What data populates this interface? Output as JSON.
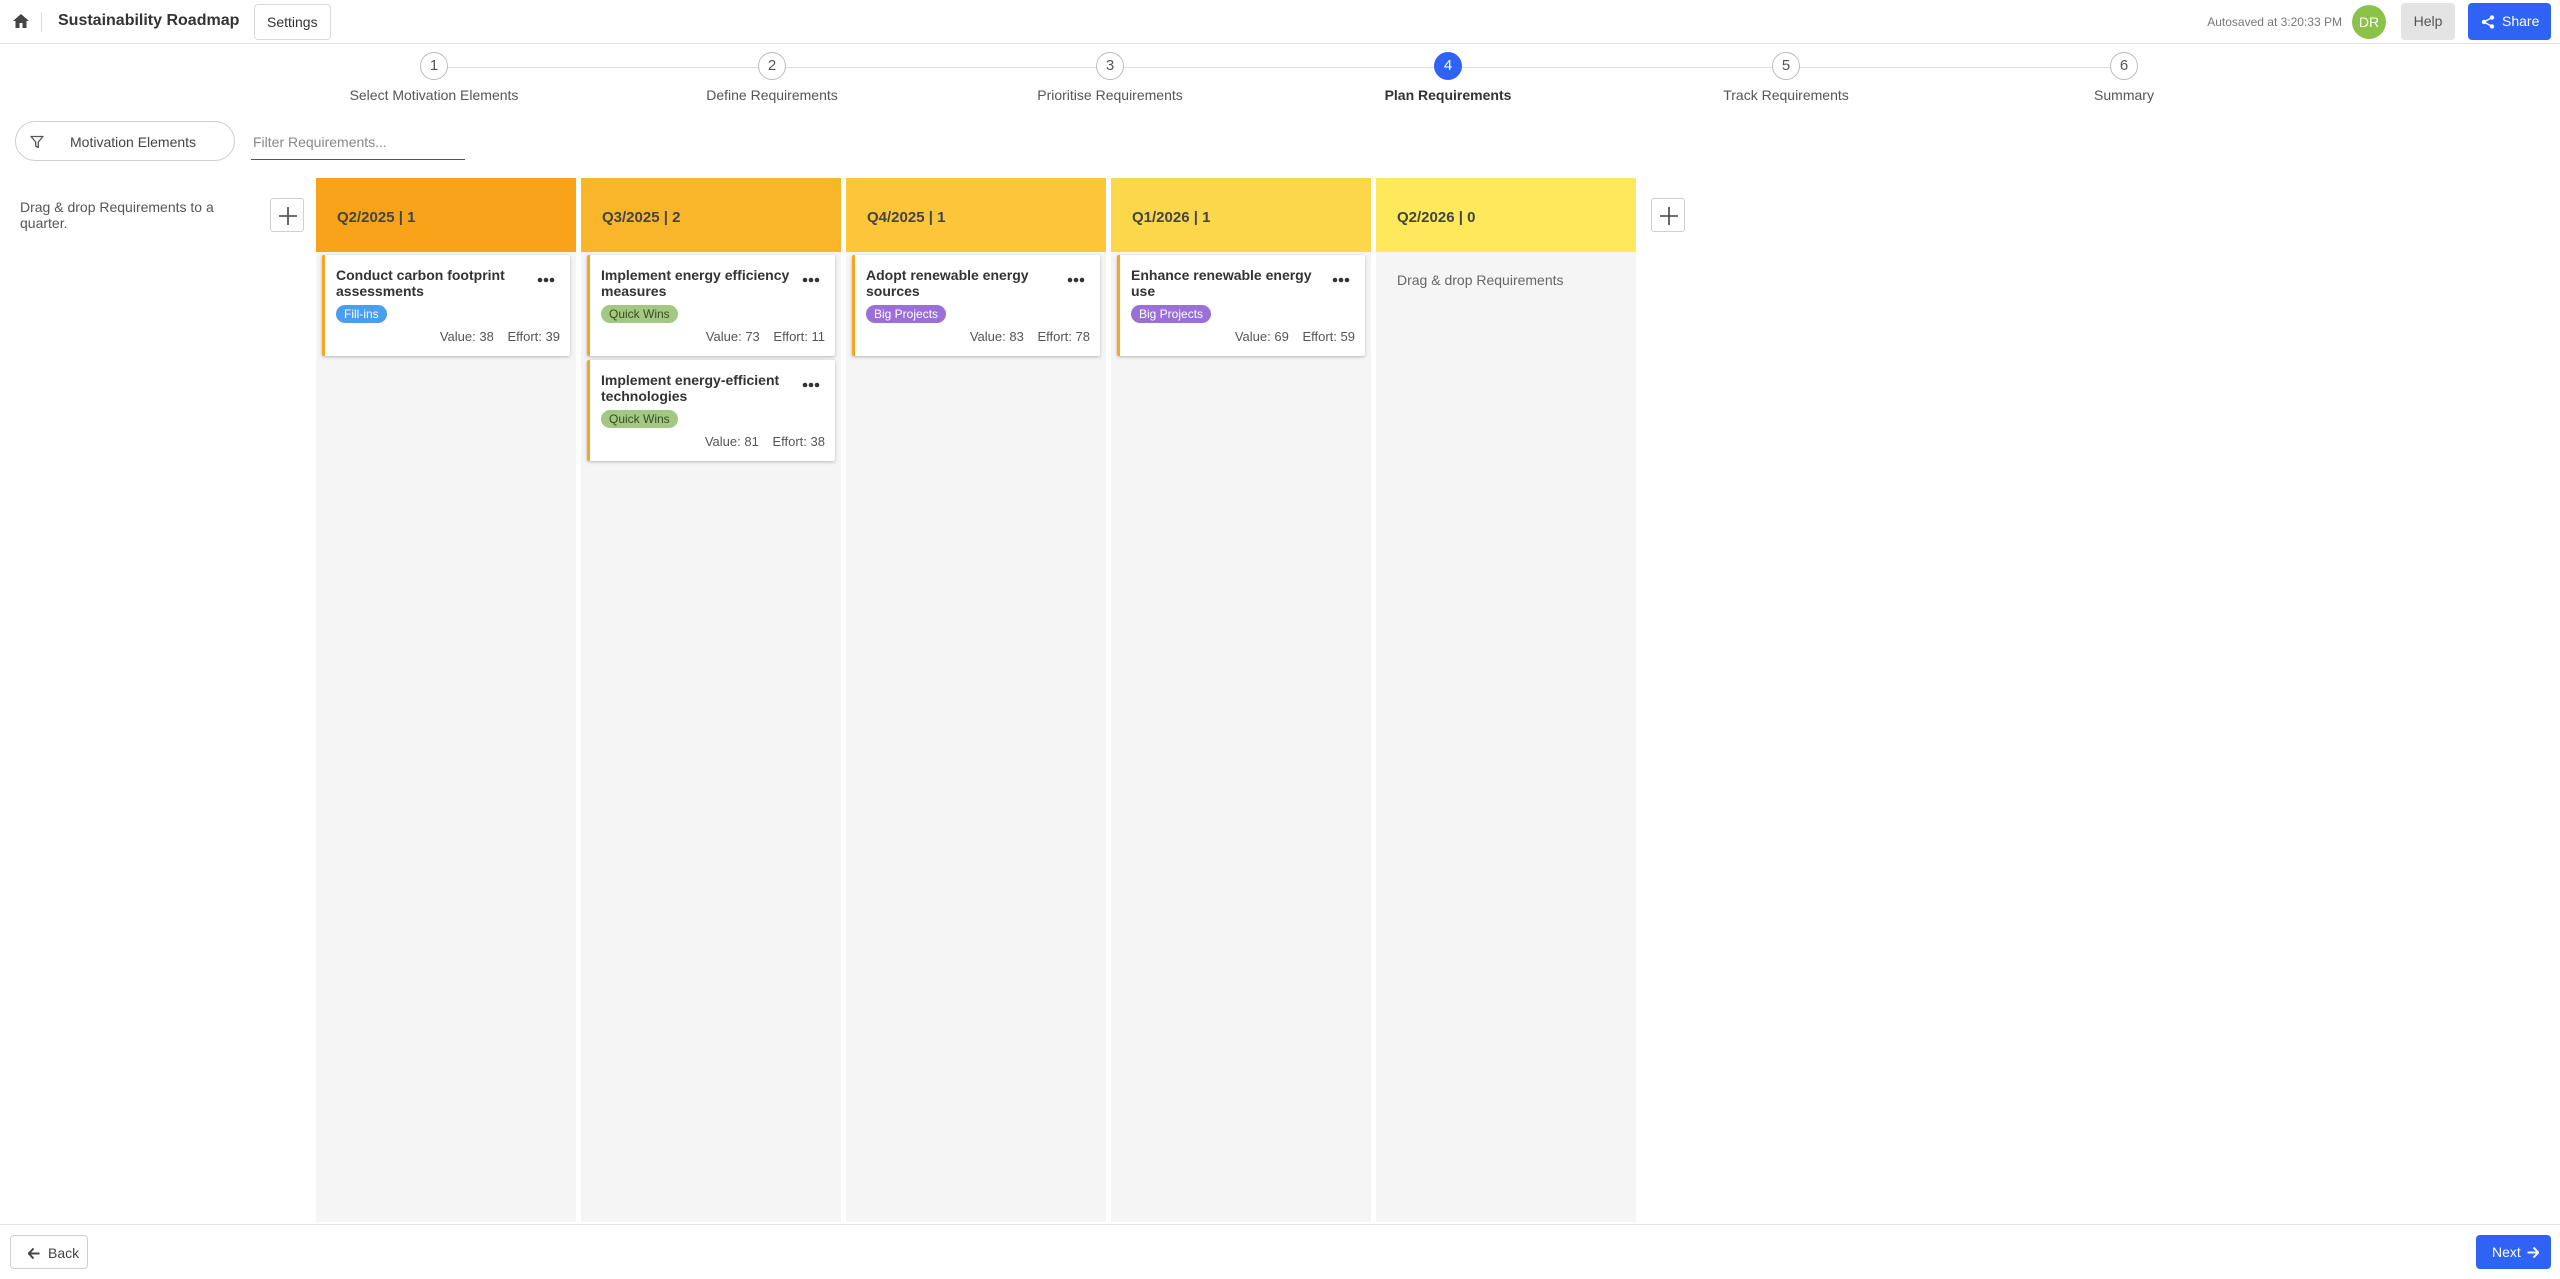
{
  "header": {
    "app_title": "Sustainability Roadmap",
    "settings_label": "Settings",
    "autosave_text": "Autosaved at 3:20:33 PM",
    "avatar_initials": "DR",
    "help_label": "Help",
    "share_label": "Share",
    "home_icon": "home-icon",
    "share_icon": "share-icon"
  },
  "stepper": {
    "active_step": 4,
    "steps": [
      {
        "number": "1",
        "label": "Select Motivation Elements"
      },
      {
        "number": "2",
        "label": "Define Requirements"
      },
      {
        "number": "3",
        "label": "Prioritise Requirements"
      },
      {
        "number": "4",
        "label": "Plan Requirements"
      },
      {
        "number": "5",
        "label": "Track Requirements"
      },
      {
        "number": "6",
        "label": "Summary"
      }
    ]
  },
  "filters": {
    "motivation_label": "Motivation Elements",
    "filter_placeholder": "Filter Requirements...",
    "filter_value": ""
  },
  "board": {
    "hint": "Drag & drop Requirements to a quarter.",
    "empty_hint": "Drag & drop Requirements",
    "metric_value_label": "Value:",
    "metric_effort_label": "Effort:",
    "columns": [
      {
        "title": "Q2/2025 | 1",
        "color": "#f9a31a",
        "cards": [
          {
            "title": "Conduct carbon footprint assessments",
            "tag": "Fill-ins",
            "tag_bg": "#4a9ef0",
            "tag_fg": "#ffffff",
            "value": 38,
            "effort": 39
          }
        ]
      },
      {
        "title": "Q3/2025 | 2",
        "color": "#fab62b",
        "cards": [
          {
            "title": "Implement energy efficiency measures",
            "tag": "Quick Wins",
            "tag_bg": "#a3c884",
            "tag_fg": "#2f4f1f",
            "value": 73,
            "effort": 11
          },
          {
            "title": "Implement energy-efficient technologies",
            "tag": "Quick Wins",
            "tag_bg": "#a3c884",
            "tag_fg": "#2f4f1f",
            "value": 81,
            "effort": 38
          }
        ]
      },
      {
        "title": "Q4/2025 | 1",
        "color": "#fdc53a",
        "cards": [
          {
            "title": "Adopt renewable energy sources",
            "tag": "Big Projects",
            "tag_bg": "#9b6fd8",
            "tag_fg": "#ffffff",
            "value": 83,
            "effort": 78
          }
        ]
      },
      {
        "title": "Q1/2026 | 1",
        "color": "#fdd74a",
        "cards": [
          {
            "title": "Enhance renewable energy use",
            "tag": "Big Projects",
            "tag_bg": "#9b6fd8",
            "tag_fg": "#ffffff",
            "value": 69,
            "effort": 59
          }
        ]
      },
      {
        "title": "Q2/2026 | 0",
        "color": "#fee95d",
        "cards": []
      }
    ]
  },
  "footer": {
    "back_label": "Back",
    "next_label": "Next"
  }
}
